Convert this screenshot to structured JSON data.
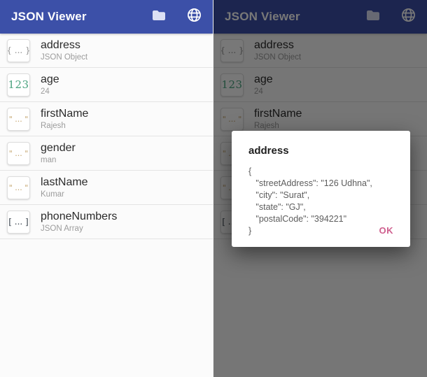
{
  "app": {
    "title": "JSON Viewer",
    "accent_color": "#3c50a8",
    "ok_color": "#cf5f8e",
    "number_color": "#4aa37f",
    "string_color": "#c2a168",
    "object_color": "#8f8f8f",
    "array_color": "#353f49"
  },
  "appbar": {
    "title": "JSON Viewer",
    "folder_icon": "folder-icon",
    "globe_icon": "globe-icon"
  },
  "list": {
    "items": [
      {
        "key": "address",
        "sub": "JSON Object",
        "type": "object",
        "badge": "{ ... }"
      },
      {
        "key": "age",
        "sub": "24",
        "type": "number",
        "badge": "123"
      },
      {
        "key": "firstName",
        "sub": "Rajesh",
        "type": "string",
        "badge": "\" ... \""
      },
      {
        "key": "gender",
        "sub": "man",
        "type": "string",
        "badge": "\" ... \""
      },
      {
        "key": "lastName",
        "sub": "Kumar",
        "type": "string",
        "badge": "\" ... \""
      },
      {
        "key": "phoneNumbers",
        "sub": "JSON Array",
        "type": "array",
        "badge": "[ ... ]"
      }
    ]
  },
  "dialog": {
    "title": "address",
    "body": "{\n   \"streetAddress\": \"126 Udhna\",\n   \"city\": \"Surat\",\n   \"state\": \"GJ\",\n   \"postalCode\": \"394221\"\n}",
    "ok_label": "OK"
  }
}
